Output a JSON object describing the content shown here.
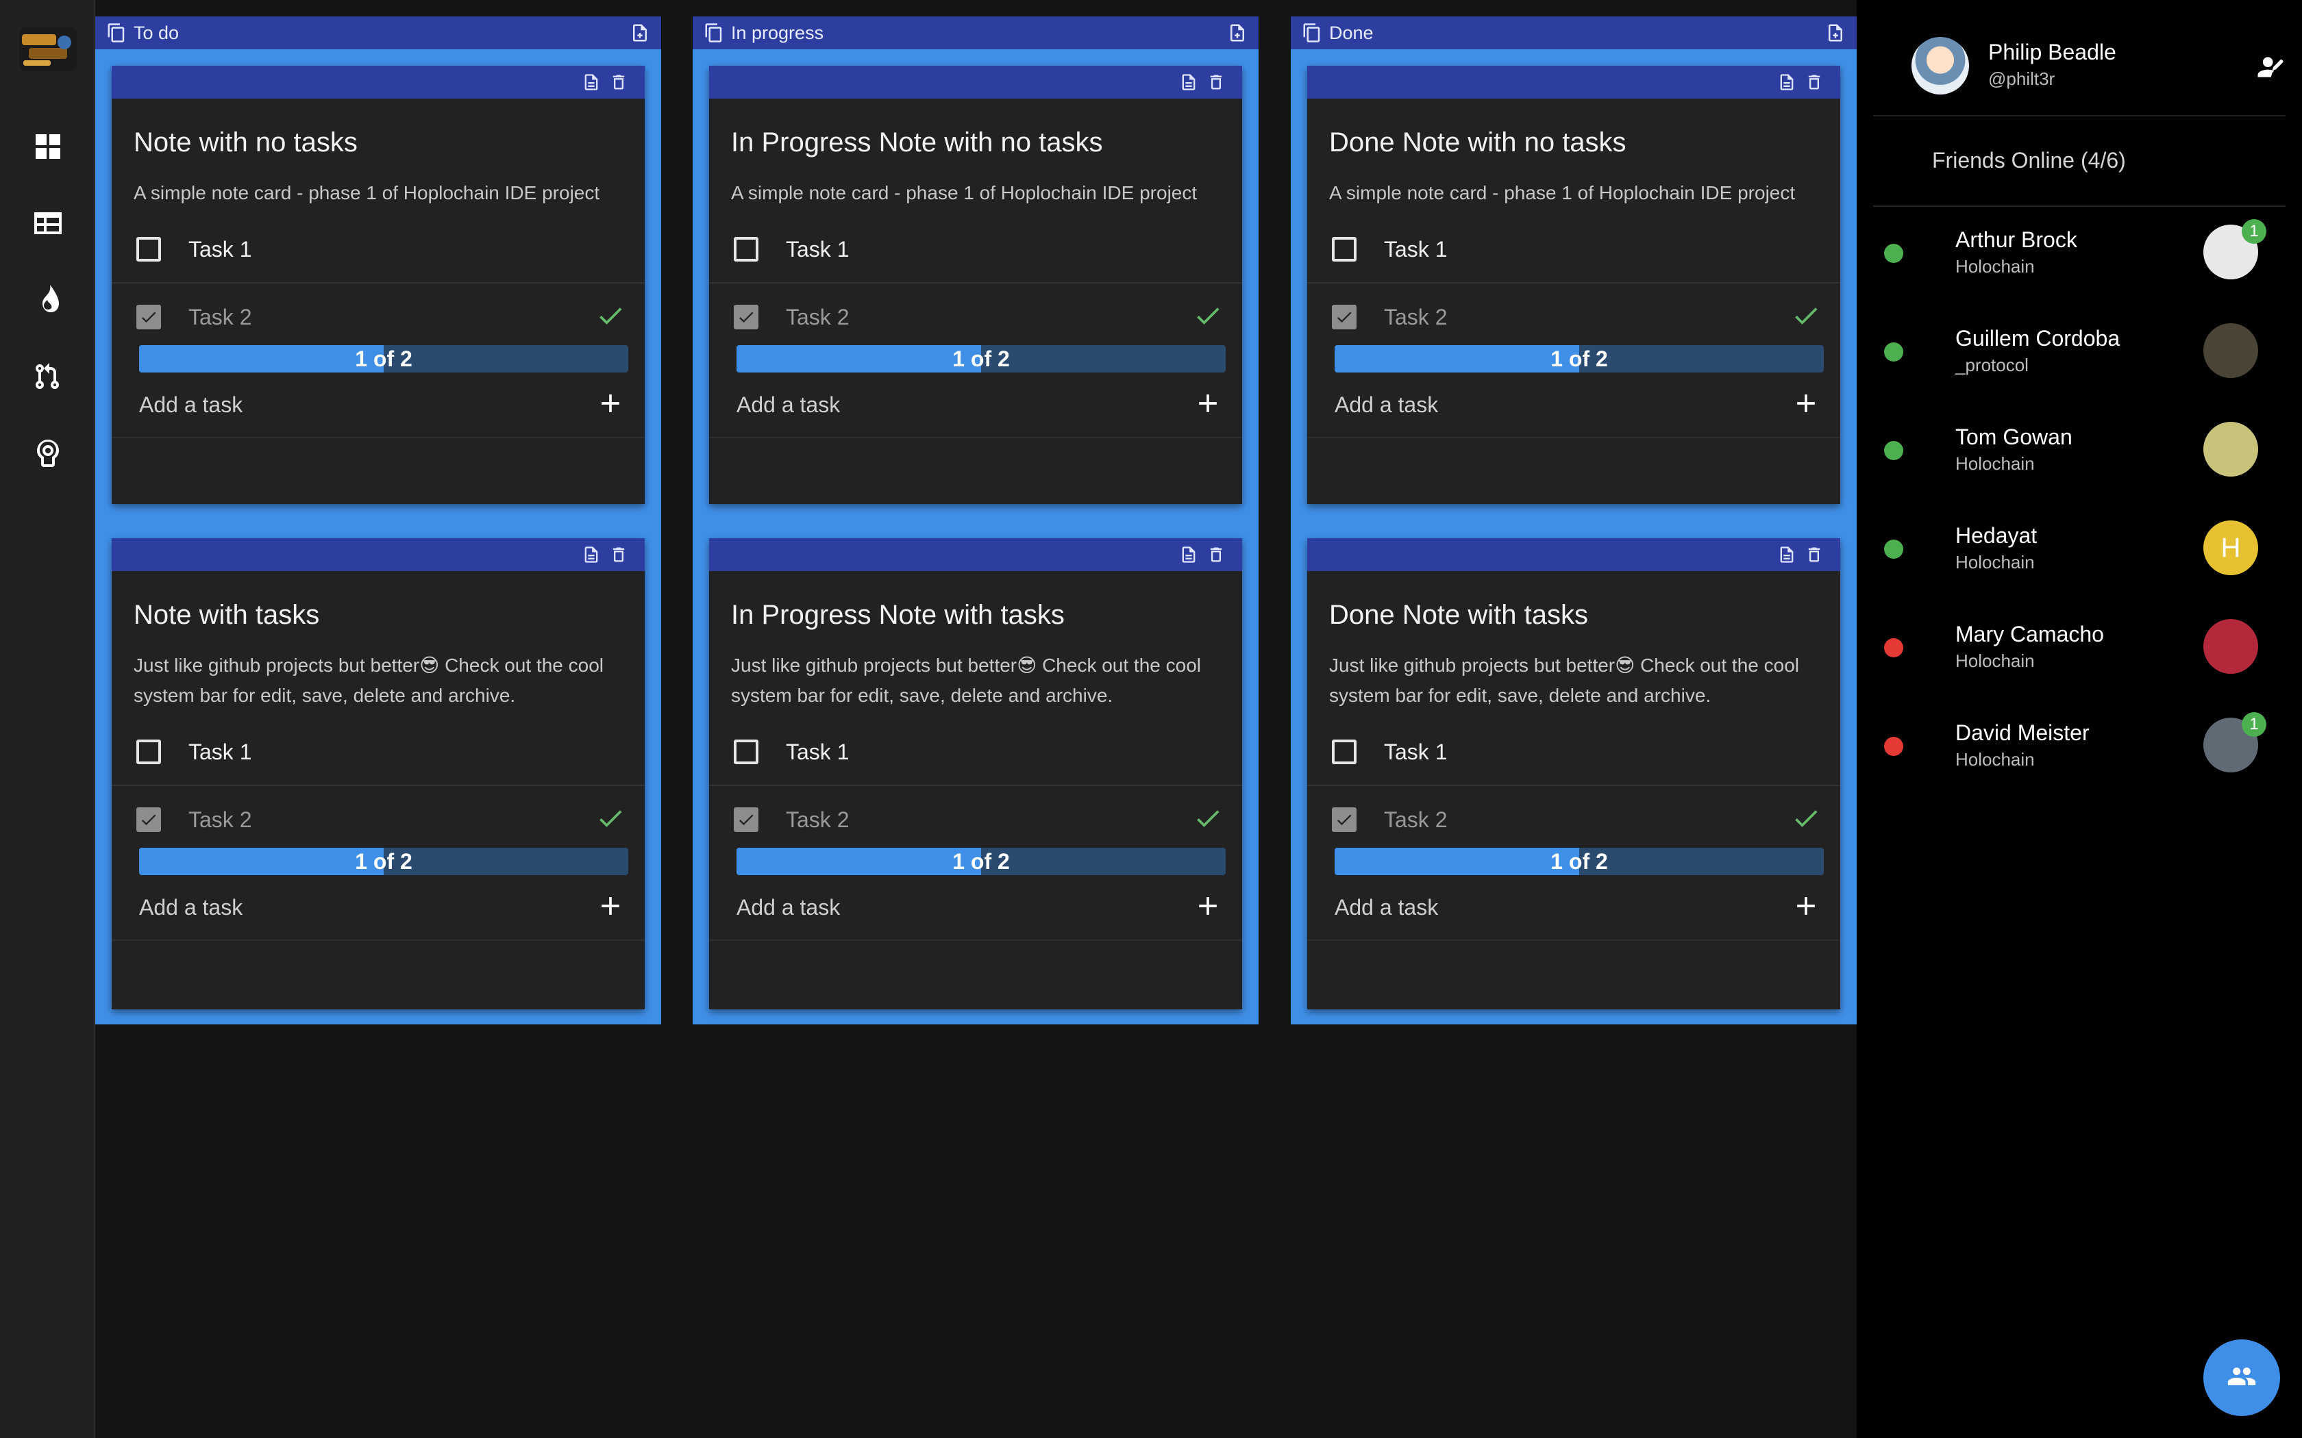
{
  "nav": {
    "items": [
      {
        "name": "dashboard-icon",
        "label": "Dashboard"
      },
      {
        "name": "table-icon",
        "label": "Board"
      },
      {
        "name": "fire-icon",
        "label": "Hot"
      },
      {
        "name": "pull-request-icon",
        "label": "Pull requests"
      },
      {
        "name": "brain-icon",
        "label": "Ideas"
      }
    ]
  },
  "columns": [
    {
      "title": "To do",
      "cards": [
        {
          "title": "Note with no tasks",
          "description": "A simple note card - phase 1 of Hoplochain IDE project",
          "tasks": [
            {
              "label": "Task 1",
              "done": false
            },
            {
              "label": "Task 2",
              "done": true
            }
          ],
          "progress_label": "1 of 2",
          "progress": 0.5,
          "add_label": "Add a task"
        },
        {
          "title": "Note with tasks",
          "description": "Just like github projects but better😎 Check out the cool system bar for edit, save, delete and archive.",
          "tasks": [
            {
              "label": "Task 1",
              "done": false
            },
            {
              "label": "Task 2",
              "done": true
            }
          ],
          "progress_label": "1 of 2",
          "progress": 0.5,
          "add_label": "Add a task"
        }
      ]
    },
    {
      "title": "In progress",
      "cards": [
        {
          "title": "In Progress Note with no tasks",
          "description": "A simple note card - phase 1 of Hoplochain IDE project",
          "tasks": [
            {
              "label": "Task 1",
              "done": false
            },
            {
              "label": "Task 2",
              "done": true
            }
          ],
          "progress_label": "1 of 2",
          "progress": 0.5,
          "add_label": "Add a task"
        },
        {
          "title": "In Progress Note with tasks",
          "description": "Just like github projects but better😎 Check out the cool system bar for edit, save, delete and archive.",
          "tasks": [
            {
              "label": "Task 1",
              "done": false
            },
            {
              "label": "Task 2",
              "done": true
            }
          ],
          "progress_label": "1 of 2",
          "progress": 0.5,
          "add_label": "Add a task"
        }
      ]
    },
    {
      "title": "Done",
      "cards": [
        {
          "title": "Done Note with no tasks",
          "description": "A simple note card - phase 1 of Hoplochain IDE project",
          "tasks": [
            {
              "label": "Task 1",
              "done": false
            },
            {
              "label": "Task 2",
              "done": true
            }
          ],
          "progress_label": "1 of 2",
          "progress": 0.5,
          "add_label": "Add a task"
        },
        {
          "title": "Done Note with tasks",
          "description": "Just like github projects but better😎 Check out the cool system bar for edit, save, delete and archive.",
          "tasks": [
            {
              "label": "Task 1",
              "done": false
            },
            {
              "label": "Task 2",
              "done": true
            }
          ],
          "progress_label": "1 of 2",
          "progress": 0.5,
          "add_label": "Add a task"
        }
      ]
    }
  ],
  "profile": {
    "name": "Philip Beadle",
    "handle": "@philt3r"
  },
  "friends_header": "Friends Online (4/6)",
  "friends": [
    {
      "name": "Arthur Brock",
      "subtitle": "Holochain",
      "online": true,
      "badge": "1",
      "avatar_color": "#e8e8e8",
      "initial": ""
    },
    {
      "name": "Guillem Cordoba",
      "subtitle": "_protocol",
      "online": true,
      "badge": "",
      "avatar_color": "#4a4436",
      "initial": ""
    },
    {
      "name": "Tom Gowan",
      "subtitle": "Holochain",
      "online": true,
      "badge": "",
      "avatar_color": "#c9c27a",
      "initial": ""
    },
    {
      "name": "Hedayat",
      "subtitle": "Holochain",
      "online": true,
      "badge": "",
      "avatar_color": "#e6c233",
      "initial": "H"
    },
    {
      "name": "Mary Camacho",
      "subtitle": "Holochain",
      "online": false,
      "badge": "",
      "avatar_color": "#b3283a",
      "initial": ""
    },
    {
      "name": "David Meister",
      "subtitle": "Holochain",
      "online": false,
      "badge": "1",
      "avatar_color": "#5f6a75",
      "initial": ""
    }
  ],
  "colors": {
    "online": "#4caf50",
    "offline": "#e53935",
    "accent": "#3f8fe8",
    "bar": "#2d3da0"
  }
}
